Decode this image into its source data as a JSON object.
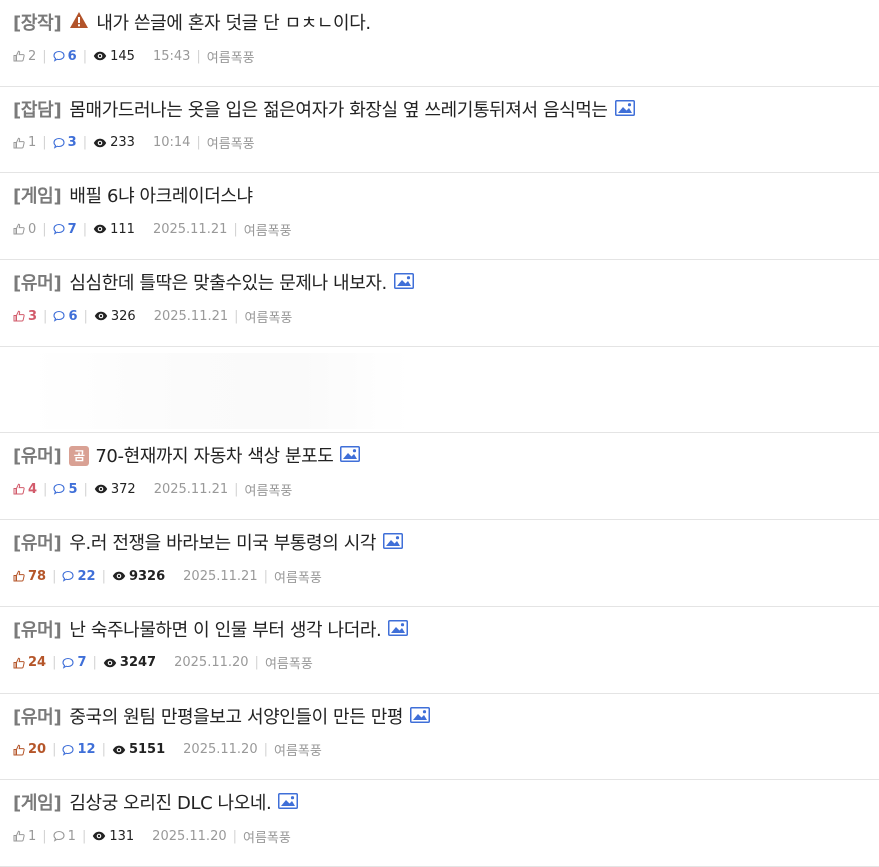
{
  "posts": [
    {
      "category": "[장작]",
      "prefix_icon": "warning-icon",
      "title": "내가 쓴글에 혼자 덧글 단 ㅁㅊㄴ이다.",
      "has_image": false,
      "likes": "2",
      "comments": "6",
      "views": "145",
      "time": "15:43",
      "author": "여름폭풍",
      "likes_style": "normal",
      "comments_style": "blue",
      "views_style": "normal"
    },
    {
      "category": "[잡담]",
      "prefix_icon": "",
      "title": "몸매가드러나는 옷을 입은 젊은여자가 화장실 옆 쓰레기통뒤져서 음식먹는",
      "has_image": true,
      "likes": "1",
      "comments": "3",
      "views": "233",
      "time": "10:14",
      "author": "여름폭풍",
      "likes_style": "normal",
      "comments_style": "blue",
      "views_style": "normal"
    },
    {
      "category": "[게임]",
      "prefix_icon": "",
      "title": "배필 6냐 아크레이더스냐",
      "has_image": false,
      "likes": "0",
      "comments": "7",
      "views": "111",
      "time": "2025.11.21",
      "author": "여름폭풍",
      "likes_style": "normal",
      "comments_style": "blue",
      "views_style": "normal"
    },
    {
      "category": "[유머]",
      "prefix_icon": "",
      "title": "심심한데 틀딱은 맞출수있는 문제나 내보자.",
      "has_image": true,
      "likes": "3",
      "comments": "6",
      "views": "326",
      "time": "2025.11.21",
      "author": "여름폭풍",
      "likes_style": "hot",
      "comments_style": "blue",
      "views_style": "normal"
    },
    {
      "ad": true
    },
    {
      "category": "[유머]",
      "prefix_icon": "gom-icon",
      "prefix_text": "곰",
      "title": "70-현재까지 자동차 색상 분포도",
      "has_image": true,
      "likes": "4",
      "comments": "5",
      "views": "372",
      "time": "2025.11.21",
      "author": "여름폭풍",
      "likes_style": "hot",
      "comments_style": "blue",
      "views_style": "normal"
    },
    {
      "category": "[유머]",
      "prefix_icon": "",
      "title": "우.러 전쟁을 바라보는 미국 부통령의 시각",
      "has_image": true,
      "likes": "78",
      "comments": "22",
      "views": "9326",
      "time": "2025.11.21",
      "author": "여름폭풍",
      "likes_style": "best",
      "comments_style": "blue",
      "views_style": "best"
    },
    {
      "category": "[유머]",
      "prefix_icon": "",
      "title": "난 숙주나물하면 이 인물 부터 생각 나더라.",
      "has_image": true,
      "likes": "24",
      "comments": "7",
      "views": "3247",
      "time": "2025.11.20",
      "author": "여름폭풍",
      "likes_style": "best",
      "comments_style": "blue",
      "views_style": "best"
    },
    {
      "category": "[유머]",
      "prefix_icon": "",
      "title": "중국의 원팀 만평을보고 서양인들이 만든 만평",
      "has_image": true,
      "likes": "20",
      "comments": "12",
      "views": "5151",
      "time": "2025.11.20",
      "author": "여름폭풍",
      "likes_style": "best",
      "comments_style": "blue",
      "views_style": "best"
    },
    {
      "category": "[게임]",
      "prefix_icon": "",
      "title": "김상궁 오리진 DLC 나오네.",
      "has_image": true,
      "likes": "1",
      "comments": "1",
      "views": "131",
      "time": "2025.11.20",
      "author": "여름폭풍",
      "likes_style": "normal",
      "comments_style": "plain",
      "views_style": "normal"
    }
  ],
  "colors": {
    "category": "#7a7a7a",
    "title": "#222222",
    "comment_count": "#3f6fd8",
    "hot_like": "#d25b6b",
    "best_like": "#b5562a",
    "meta": "#999999",
    "warning": "#b2532a"
  }
}
